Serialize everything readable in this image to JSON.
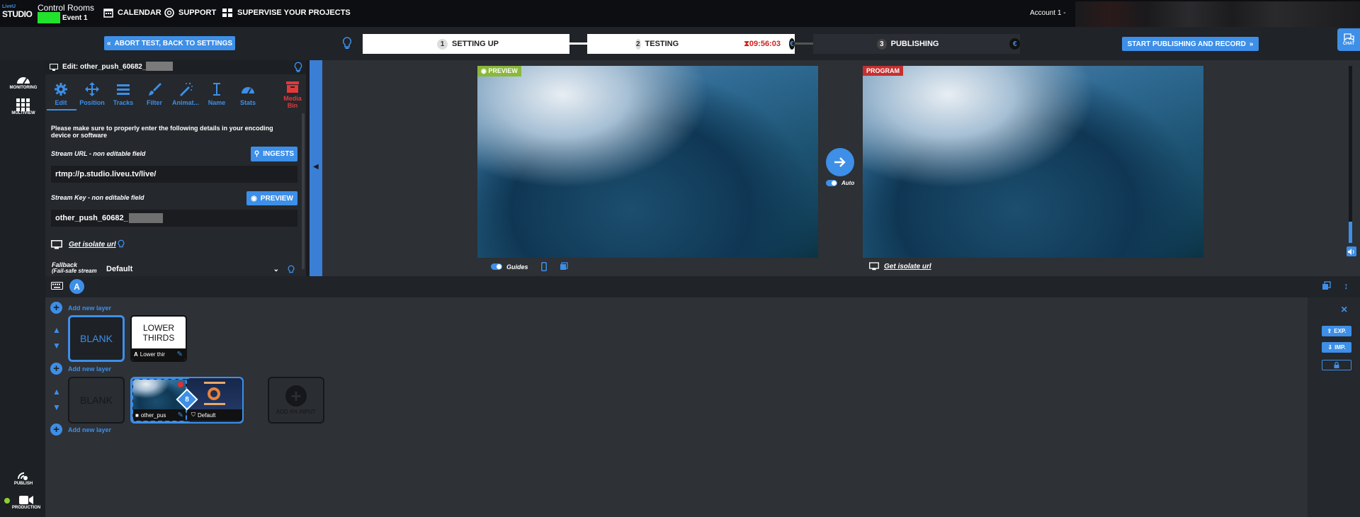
{
  "brand": {
    "logo_top": "LiveU",
    "logo_bottom": "STUDIO"
  },
  "header": {
    "control_rooms": "Control Rooms",
    "event": "Event 1",
    "nav": [
      {
        "label": "CALENDAR",
        "icon": "calendar-icon"
      },
      {
        "label": "SUPPORT",
        "icon": "lifebuoy-icon"
      },
      {
        "label": "SUPERVISE YOUR PROJECTS",
        "icon": "grid-icon"
      }
    ],
    "account": "Account 1 -"
  },
  "steps": {
    "abort_label": "ABORT TEST, BACK TO SETTINGS",
    "items": [
      {
        "num": "1",
        "label": "SETTING UP"
      },
      {
        "num": "2",
        "label": "TESTING",
        "timer": "09:56:03"
      },
      {
        "num": "3",
        "label": "PUBLISHING"
      }
    ],
    "euro_symbol": "€",
    "start_label": "START PUBLISHING AND RECORD"
  },
  "chat": {
    "label": "CHAT"
  },
  "rail": {
    "monitoring": "MONITORING",
    "multiview": "MULTIVIEW",
    "publish": "PUBLISH",
    "production": "PRODUCTION"
  },
  "edit_panel": {
    "title": "Edit: other_push_60682_",
    "tools": [
      "Edit",
      "Position",
      "Tracks",
      "Filter",
      "Animat...",
      "Name",
      "Stats"
    ],
    "media_bin": [
      "Media",
      "Bin"
    ],
    "notice": "Please make sure to properly enter the following details in your encoding device or software",
    "stream_url_label": "Stream URL - non editable field",
    "ingests_label": "INGESTS",
    "stream_url": "rtmp://p.studio.liveu.tv/live/",
    "stream_key_label": "Stream Key - non editable field",
    "preview_label": "PREVIEW",
    "stream_key": "other_push_60682_",
    "isolate_link": "Get isolate url",
    "fallback_label": "Fallback",
    "fallback_sub": "(Fail-safe stream",
    "fallback_value": "Default"
  },
  "viewer": {
    "preview_tag": "PREVIEW",
    "program_tag": "PROGRAM",
    "auto_label": "Auto",
    "guides_label": "Guides",
    "isolate_link": "Get isolate url"
  },
  "layers": {
    "scene_letter": "A",
    "add_layer": "Add new layer",
    "blank": "BLANK",
    "lower_thirds_title": [
      "LOWER",
      "THIRDS"
    ],
    "lower_thirds_caption": "Lower thir",
    "input_caption": "other_pus",
    "input_badge": "8",
    "default_caption": "Default",
    "add_input": "ADD AN INPUT"
  },
  "right_controls": {
    "close": "×",
    "exp": "EXP.",
    "imp": "IMP."
  }
}
